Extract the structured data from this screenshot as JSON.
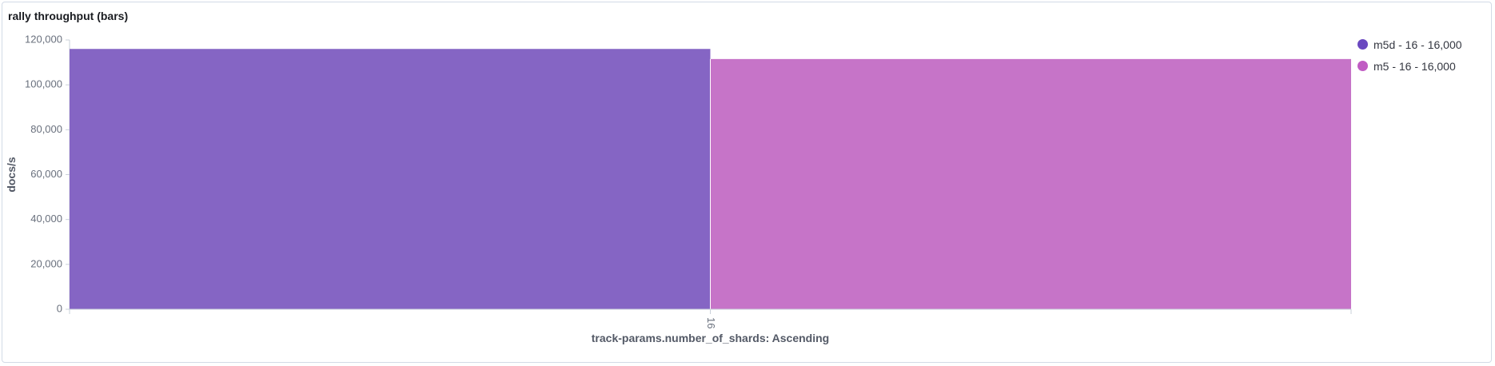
{
  "panel": {
    "title": "rally throughput (bars)"
  },
  "chart_data": {
    "type": "bar",
    "title": "rally throughput (bars)",
    "xlabel": "track-params.number_of_shards: Ascending",
    "ylabel": "docs/s",
    "categories": [
      "16"
    ],
    "ylim": [
      0,
      120000
    ],
    "yticks": [
      0,
      20000,
      40000,
      60000,
      80000,
      100000,
      120000
    ],
    "ytick_labels": [
      "0",
      "20,000",
      "40,000",
      "60,000",
      "80,000",
      "100,000",
      "120,000"
    ],
    "grid": false,
    "legend_position": "top-right",
    "series": [
      {
        "name": "m5d - 16 - 16,000",
        "color": "#8565c4",
        "values": [
          116000
        ]
      },
      {
        "name": "m5 - 16 - 16,000",
        "color": "#c674c8",
        "values": [
          111500
        ]
      }
    ]
  },
  "legend": {
    "marker_colors": [
      "#6a48c0",
      "#c05cc3"
    ]
  }
}
